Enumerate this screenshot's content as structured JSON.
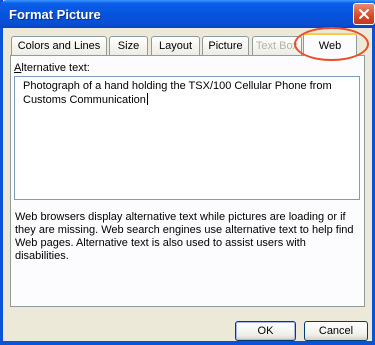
{
  "window": {
    "title": "Format Picture"
  },
  "tabs": [
    {
      "label": "Colors and Lines",
      "state": "normal"
    },
    {
      "label": "Size",
      "state": "normal"
    },
    {
      "label": "Layout",
      "state": "normal"
    },
    {
      "label": "Picture",
      "state": "normal"
    },
    {
      "label": "Text Box",
      "state": "disabled"
    },
    {
      "label": "Web",
      "state": "active"
    }
  ],
  "web_tab": {
    "alt_label_access_key": "A",
    "alt_label_rest": "lternative text:",
    "alt_text_value": "Photograph of a hand holding the TSX/100 Cellular Phone from Customs Communication",
    "help_text": "Web browsers display alternative text while pictures are loading or if they are missing.  Web search engines use alternative text to help find Web pages.  Alternative text is also used to assist users with disabilities."
  },
  "buttons": {
    "ok": "OK",
    "cancel": "Cancel"
  },
  "colors": {
    "titlebar": "#0553de",
    "dialog_bg": "#ece9d8",
    "highlight_ring": "#e84e2a",
    "active_tab_accent": "#ffc83c"
  },
  "icons": {
    "close": "close-icon"
  }
}
